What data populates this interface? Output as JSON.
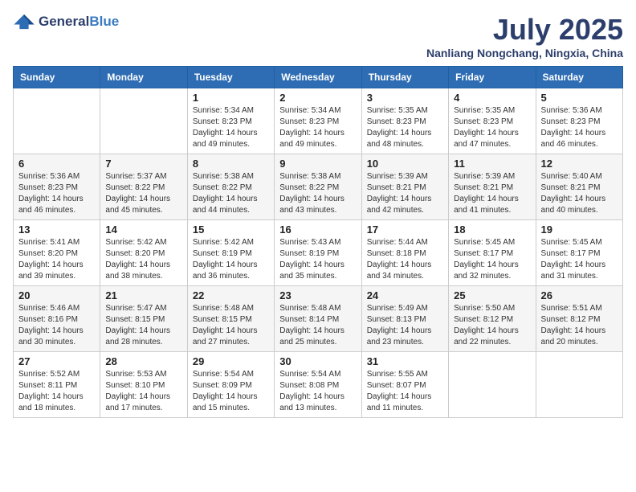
{
  "header": {
    "logo_general": "General",
    "logo_blue": "Blue",
    "month_title": "July 2025",
    "location": "Nanliang Nongchang, Ningxia, China"
  },
  "weekdays": [
    "Sunday",
    "Monday",
    "Tuesday",
    "Wednesday",
    "Thursday",
    "Friday",
    "Saturday"
  ],
  "weeks": [
    [
      {
        "day": "",
        "sunrise": "",
        "sunset": "",
        "daylight": ""
      },
      {
        "day": "",
        "sunrise": "",
        "sunset": "",
        "daylight": ""
      },
      {
        "day": "1",
        "sunrise": "Sunrise: 5:34 AM",
        "sunset": "Sunset: 8:23 PM",
        "daylight": "Daylight: 14 hours and 49 minutes."
      },
      {
        "day": "2",
        "sunrise": "Sunrise: 5:34 AM",
        "sunset": "Sunset: 8:23 PM",
        "daylight": "Daylight: 14 hours and 49 minutes."
      },
      {
        "day": "3",
        "sunrise": "Sunrise: 5:35 AM",
        "sunset": "Sunset: 8:23 PM",
        "daylight": "Daylight: 14 hours and 48 minutes."
      },
      {
        "day": "4",
        "sunrise": "Sunrise: 5:35 AM",
        "sunset": "Sunset: 8:23 PM",
        "daylight": "Daylight: 14 hours and 47 minutes."
      },
      {
        "day": "5",
        "sunrise": "Sunrise: 5:36 AM",
        "sunset": "Sunset: 8:23 PM",
        "daylight": "Daylight: 14 hours and 46 minutes."
      }
    ],
    [
      {
        "day": "6",
        "sunrise": "Sunrise: 5:36 AM",
        "sunset": "Sunset: 8:23 PM",
        "daylight": "Daylight: 14 hours and 46 minutes."
      },
      {
        "day": "7",
        "sunrise": "Sunrise: 5:37 AM",
        "sunset": "Sunset: 8:22 PM",
        "daylight": "Daylight: 14 hours and 45 minutes."
      },
      {
        "day": "8",
        "sunrise": "Sunrise: 5:38 AM",
        "sunset": "Sunset: 8:22 PM",
        "daylight": "Daylight: 14 hours and 44 minutes."
      },
      {
        "day": "9",
        "sunrise": "Sunrise: 5:38 AM",
        "sunset": "Sunset: 8:22 PM",
        "daylight": "Daylight: 14 hours and 43 minutes."
      },
      {
        "day": "10",
        "sunrise": "Sunrise: 5:39 AM",
        "sunset": "Sunset: 8:21 PM",
        "daylight": "Daylight: 14 hours and 42 minutes."
      },
      {
        "day": "11",
        "sunrise": "Sunrise: 5:39 AM",
        "sunset": "Sunset: 8:21 PM",
        "daylight": "Daylight: 14 hours and 41 minutes."
      },
      {
        "day": "12",
        "sunrise": "Sunrise: 5:40 AM",
        "sunset": "Sunset: 8:21 PM",
        "daylight": "Daylight: 14 hours and 40 minutes."
      }
    ],
    [
      {
        "day": "13",
        "sunrise": "Sunrise: 5:41 AM",
        "sunset": "Sunset: 8:20 PM",
        "daylight": "Daylight: 14 hours and 39 minutes."
      },
      {
        "day": "14",
        "sunrise": "Sunrise: 5:42 AM",
        "sunset": "Sunset: 8:20 PM",
        "daylight": "Daylight: 14 hours and 38 minutes."
      },
      {
        "day": "15",
        "sunrise": "Sunrise: 5:42 AM",
        "sunset": "Sunset: 8:19 PM",
        "daylight": "Daylight: 14 hours and 36 minutes."
      },
      {
        "day": "16",
        "sunrise": "Sunrise: 5:43 AM",
        "sunset": "Sunset: 8:19 PM",
        "daylight": "Daylight: 14 hours and 35 minutes."
      },
      {
        "day": "17",
        "sunrise": "Sunrise: 5:44 AM",
        "sunset": "Sunset: 8:18 PM",
        "daylight": "Daylight: 14 hours and 34 minutes."
      },
      {
        "day": "18",
        "sunrise": "Sunrise: 5:45 AM",
        "sunset": "Sunset: 8:17 PM",
        "daylight": "Daylight: 14 hours and 32 minutes."
      },
      {
        "day": "19",
        "sunrise": "Sunrise: 5:45 AM",
        "sunset": "Sunset: 8:17 PM",
        "daylight": "Daylight: 14 hours and 31 minutes."
      }
    ],
    [
      {
        "day": "20",
        "sunrise": "Sunrise: 5:46 AM",
        "sunset": "Sunset: 8:16 PM",
        "daylight": "Daylight: 14 hours and 30 minutes."
      },
      {
        "day": "21",
        "sunrise": "Sunrise: 5:47 AM",
        "sunset": "Sunset: 8:15 PM",
        "daylight": "Daylight: 14 hours and 28 minutes."
      },
      {
        "day": "22",
        "sunrise": "Sunrise: 5:48 AM",
        "sunset": "Sunset: 8:15 PM",
        "daylight": "Daylight: 14 hours and 27 minutes."
      },
      {
        "day": "23",
        "sunrise": "Sunrise: 5:48 AM",
        "sunset": "Sunset: 8:14 PM",
        "daylight": "Daylight: 14 hours and 25 minutes."
      },
      {
        "day": "24",
        "sunrise": "Sunrise: 5:49 AM",
        "sunset": "Sunset: 8:13 PM",
        "daylight": "Daylight: 14 hours and 23 minutes."
      },
      {
        "day": "25",
        "sunrise": "Sunrise: 5:50 AM",
        "sunset": "Sunset: 8:12 PM",
        "daylight": "Daylight: 14 hours and 22 minutes."
      },
      {
        "day": "26",
        "sunrise": "Sunrise: 5:51 AM",
        "sunset": "Sunset: 8:12 PM",
        "daylight": "Daylight: 14 hours and 20 minutes."
      }
    ],
    [
      {
        "day": "27",
        "sunrise": "Sunrise: 5:52 AM",
        "sunset": "Sunset: 8:11 PM",
        "daylight": "Daylight: 14 hours and 18 minutes."
      },
      {
        "day": "28",
        "sunrise": "Sunrise: 5:53 AM",
        "sunset": "Sunset: 8:10 PM",
        "daylight": "Daylight: 14 hours and 17 minutes."
      },
      {
        "day": "29",
        "sunrise": "Sunrise: 5:54 AM",
        "sunset": "Sunset: 8:09 PM",
        "daylight": "Daylight: 14 hours and 15 minutes."
      },
      {
        "day": "30",
        "sunrise": "Sunrise: 5:54 AM",
        "sunset": "Sunset: 8:08 PM",
        "daylight": "Daylight: 14 hours and 13 minutes."
      },
      {
        "day": "31",
        "sunrise": "Sunrise: 5:55 AM",
        "sunset": "Sunset: 8:07 PM",
        "daylight": "Daylight: 14 hours and 11 minutes."
      },
      {
        "day": "",
        "sunrise": "",
        "sunset": "",
        "daylight": ""
      },
      {
        "day": "",
        "sunrise": "",
        "sunset": "",
        "daylight": ""
      }
    ]
  ]
}
